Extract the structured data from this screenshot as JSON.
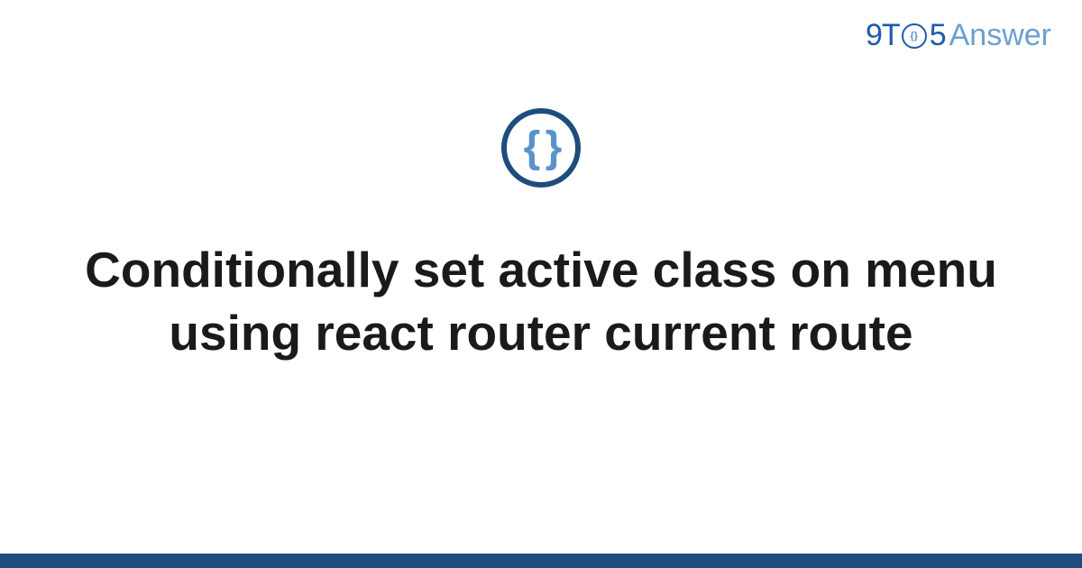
{
  "logo": {
    "part1": "9T",
    "o_inner": "{}",
    "part2": "5",
    "suffix": "Answer"
  },
  "icon": {
    "glyph": "{ }"
  },
  "title": "Conditionally set active class on menu using react router current route"
}
